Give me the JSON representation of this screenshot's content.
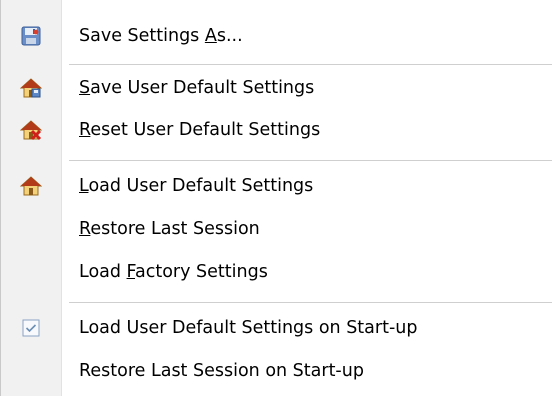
{
  "menu": {
    "items": [
      {
        "label": "Save Settings As...",
        "icon": "save-settings-icon"
      },
      {
        "label": "Save User Default Settings",
        "icon": "home-save-icon"
      },
      {
        "label": "Reset User Default Settings",
        "icon": "home-reset-icon"
      },
      {
        "label": "Load User Default Settings",
        "icon": "home-load-icon"
      },
      {
        "label": "Restore Last Session",
        "icon": ""
      },
      {
        "label": "Load Factory Settings",
        "icon": ""
      },
      {
        "label": "Load User Default Settings on Start-up",
        "icon": "checkbox-checked-icon",
        "checked": true
      },
      {
        "label": "Restore Last Session on Start-up",
        "icon": ""
      }
    ]
  },
  "colors": {
    "gutter": "#f1f1f1",
    "separator": "#cfcfcf",
    "house_roof": "#b23b1a",
    "house_wall": "#f3d27a",
    "check": "#6b8fb5"
  }
}
